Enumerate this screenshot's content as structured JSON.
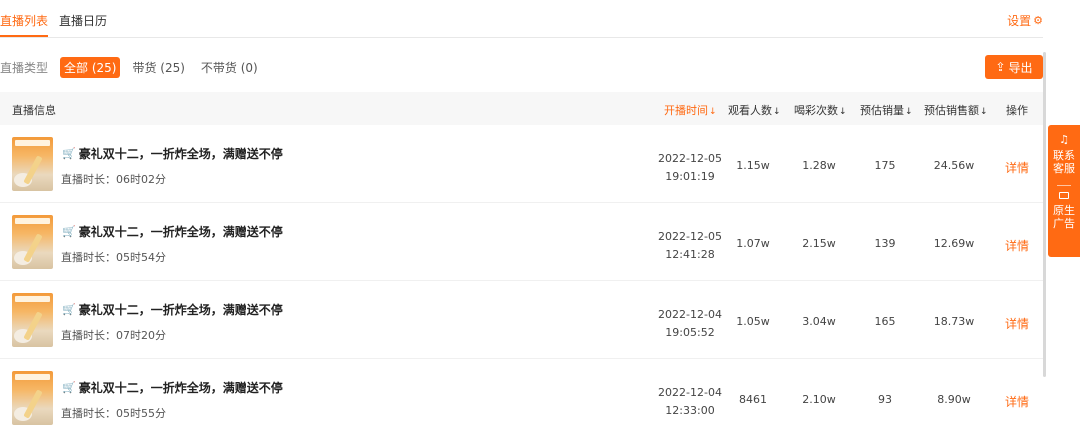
{
  "tabs": [
    {
      "label": "直播列表",
      "active": true
    },
    {
      "label": "直播日历",
      "active": false
    }
  ],
  "settings_label": "设置",
  "filters": {
    "label": "直播类型",
    "options": [
      {
        "label": "全部 (25)",
        "active": true
      },
      {
        "label": "带货 (25)",
        "active": false
      },
      {
        "label": "不带货 (0)",
        "active": false
      }
    ]
  },
  "export_label": "导出",
  "columns": {
    "info": "直播信息",
    "start_time": "开播时间",
    "viewers": "观看人数",
    "cheers": "喝彩次数",
    "sales": "预估销量",
    "revenue": "预估销售额",
    "action": "操作"
  },
  "rows": [
    {
      "title": "豪礼双十二，一折炸全场，满赠送不停",
      "duration": "直播时长：06时02分",
      "date": "2022-12-05",
      "time": "19:01:19",
      "viewers": "1.15w",
      "cheers": "1.28w",
      "sales": "175",
      "revenue": "24.56w",
      "action": "详情"
    },
    {
      "title": "豪礼双十二，一折炸全场，满赠送不停",
      "duration": "直播时长：05时54分",
      "date": "2022-12-05",
      "time": "12:41:28",
      "viewers": "1.07w",
      "cheers": "2.15w",
      "sales": "139",
      "revenue": "12.69w",
      "action": "详情"
    },
    {
      "title": "豪礼双十二，一折炸全场，满赠送不停",
      "duration": "直播时长：07时20分",
      "date": "2022-12-04",
      "time": "19:05:52",
      "viewers": "1.05w",
      "cheers": "3.04w",
      "sales": "165",
      "revenue": "18.73w",
      "action": "详情"
    },
    {
      "title": "豪礼双十二，一折炸全场，满赠送不停",
      "duration": "直播时长：05时55分",
      "date": "2022-12-04",
      "time": "12:33:00",
      "viewers": "8461",
      "cheers": "2.10w",
      "sales": "93",
      "revenue": "8.90w",
      "action": "详情"
    }
  ],
  "side_panel": {
    "contact_label": "联系客服",
    "ad_label": "原生广告"
  },
  "colors": {
    "accent": "#ff6a13"
  }
}
